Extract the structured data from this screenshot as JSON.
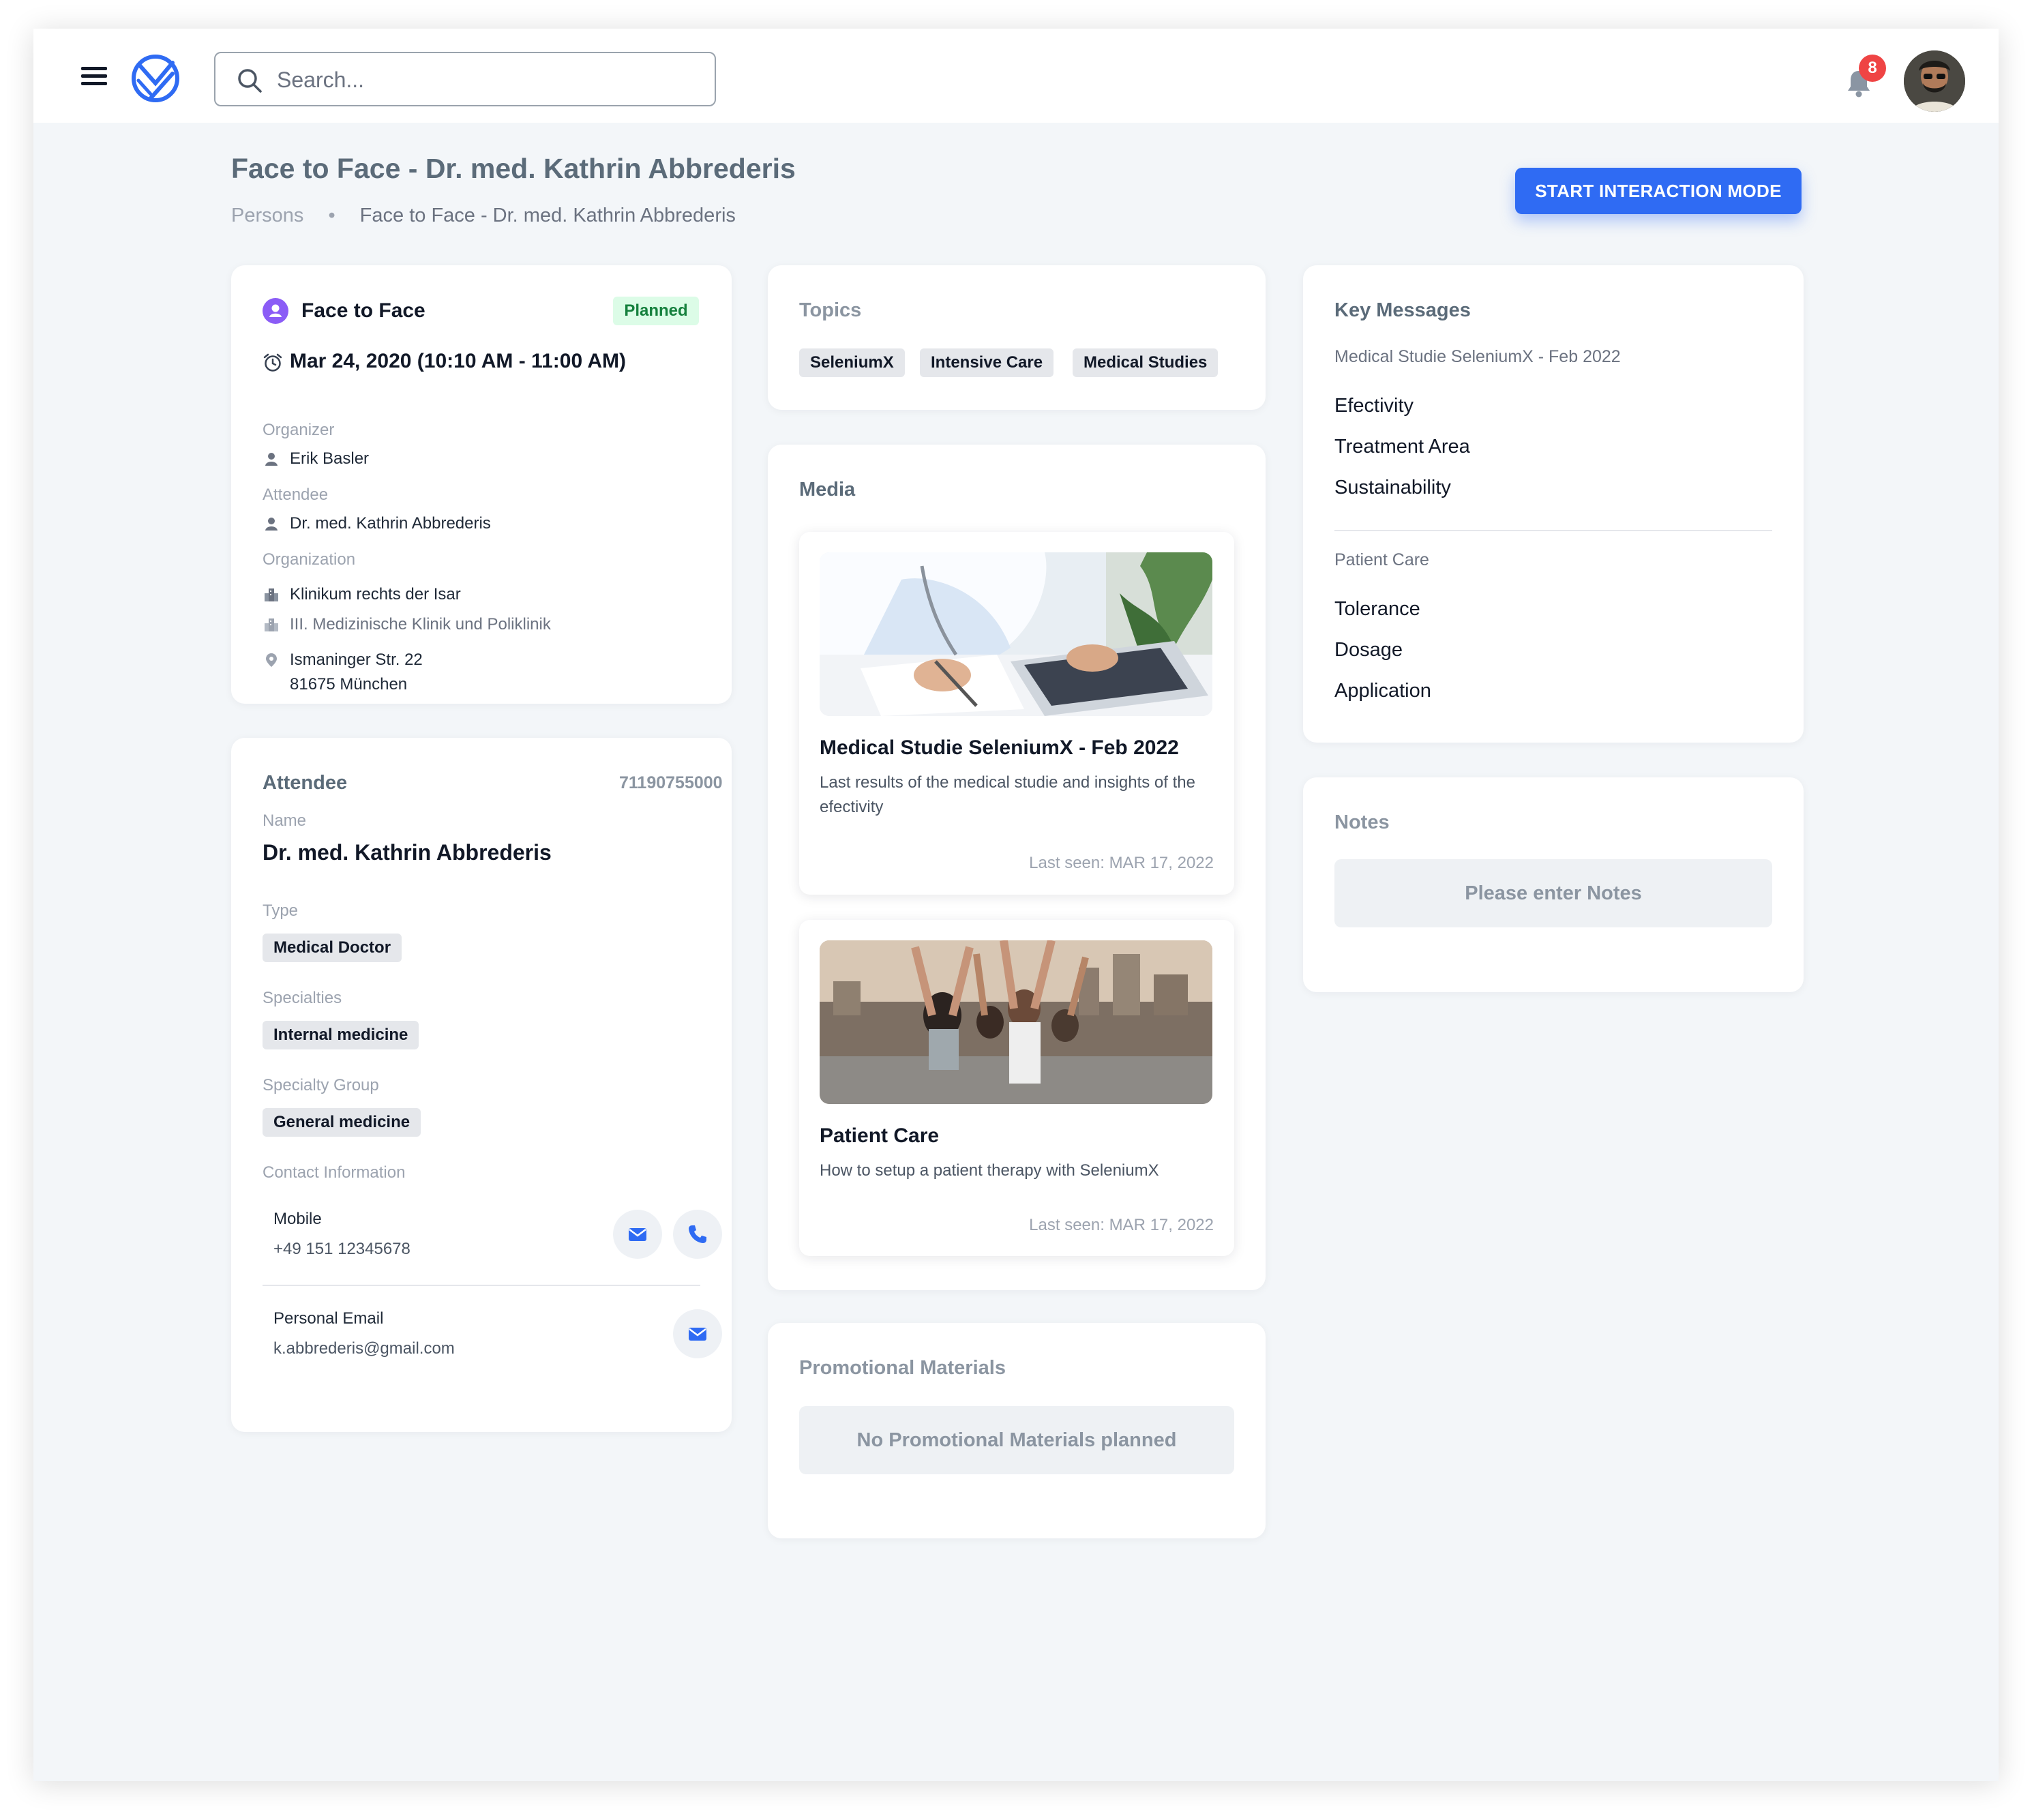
{
  "topbar": {
    "search_placeholder": "Search...",
    "notification_count": "8"
  },
  "header": {
    "title": "Face to Face - Dr. med. Kathrin Abbrederis",
    "breadcrumb": [
      "Persons",
      "Face to Face - Dr. med. Kathrin Abbrederis"
    ],
    "start_button": "START INTERACTION MODE"
  },
  "meeting": {
    "type": "Face to Face",
    "status": "Planned",
    "datetime": "Mar 24, 2020 (10:10 AM - 11:00 AM)",
    "organizer_label": "Organizer",
    "organizer": "Erik Basler",
    "attendee_label": "Attendee",
    "attendee": "Dr. med. Kathrin Abbrederis",
    "organization_label": "Organization",
    "organization": "Klinikum rechts der Isar",
    "department": "III. Medizinische Klinik und Poliklinik",
    "address_line1": "Ismaninger Str. 22",
    "address_line2": "81675 München"
  },
  "attendee": {
    "section_title": "Attendee",
    "id": "71190755000",
    "name_label": "Name",
    "name": "Dr. med. Kathrin Abbrederis",
    "type_label": "Type",
    "type": "Medical Doctor",
    "specialties_label": "Specialties",
    "specialty": "Internal medicine",
    "specialty_group_label": "Specialty Group",
    "specialty_group": "General medicine",
    "contact_label": "Contact Information",
    "mobile_label": "Mobile",
    "mobile": "+49 151 12345678",
    "email_label": "Personal Email",
    "email": "k.abbrederis@gmail.com"
  },
  "topics": {
    "title": "Topics",
    "items": [
      "SeleniumX",
      "Intensive Care",
      "Medical Studies"
    ]
  },
  "media": {
    "title": "Media",
    "items": [
      {
        "title": "Medical Studie SeleniumX - Feb 2022",
        "description": "Last results of the medical studie and insights of the efectivity",
        "last_seen": "Last seen: MAR 17, 2022"
      },
      {
        "title": "Patient Care",
        "description": "How to setup a patient therapy with SeleniumX",
        "last_seen": "Last seen: MAR 17, 2022"
      }
    ]
  },
  "promotional": {
    "title": "Promotional Materials",
    "empty_text": "No Promotional Materials planned"
  },
  "key_messages": {
    "title": "Key Messages",
    "groups": [
      {
        "name": "Medical Studie SeleniumX - Feb 2022",
        "items": [
          "Efectivity",
          "Treatment Area",
          "Sustainability"
        ]
      },
      {
        "name": "Patient Care",
        "items": [
          "Tolerance",
          "Dosage",
          "Application"
        ]
      }
    ]
  },
  "notes": {
    "title": "Notes",
    "placeholder": "Please enter Notes"
  },
  "colors": {
    "primary": "#2f6bf3",
    "background": "#f3f6f9",
    "status_green_bg": "#dcfce7",
    "status_green_text": "#15803d",
    "badge_red": "#ef4444",
    "type_purple": "#8b5cf6"
  },
  "icons": [
    "menu-icon",
    "logo-icon",
    "search-icon",
    "bell-icon",
    "user-avatar",
    "person-icon",
    "alarm-clock-icon",
    "building-icon",
    "location-pin-icon",
    "mail-icon",
    "phone-icon"
  ]
}
